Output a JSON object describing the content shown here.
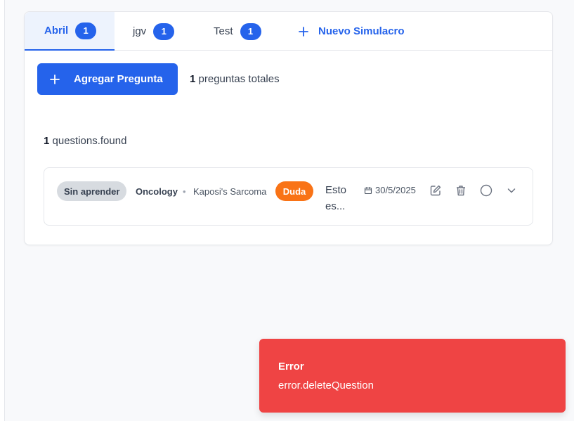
{
  "tabs": [
    {
      "label": "Abril",
      "count": "1",
      "active": true
    },
    {
      "label": "jgv",
      "count": "1",
      "active": false
    },
    {
      "label": "Test",
      "count": "1",
      "active": false
    }
  ],
  "new_tab": {
    "label": "Nuevo Simulacro",
    "icon": "plus-icon"
  },
  "toolbar": {
    "add_label": "Agregar Pregunta",
    "add_icon": "plus-icon",
    "total_count": "1",
    "total_suffix": "preguntas totales"
  },
  "found": {
    "count": "1",
    "suffix": "questions.found"
  },
  "question": {
    "status": "Sin aprender",
    "topic": "Oncology",
    "separator": "•",
    "subtopic": "Kaposi's Sarcoma",
    "tag": "Duda",
    "snippet": "Esto es...",
    "date": "30/5/2025",
    "icons": [
      "calendar-icon",
      "edit-icon",
      "trash-icon",
      "circle-icon",
      "chevron-down-icon"
    ]
  },
  "toast": {
    "title": "Error",
    "message": "error.deleteQuestion"
  },
  "colors": {
    "accent": "#2563eb",
    "tag": "#f97316",
    "error": "#ef4444",
    "status_pill": "#d7dbe0"
  }
}
